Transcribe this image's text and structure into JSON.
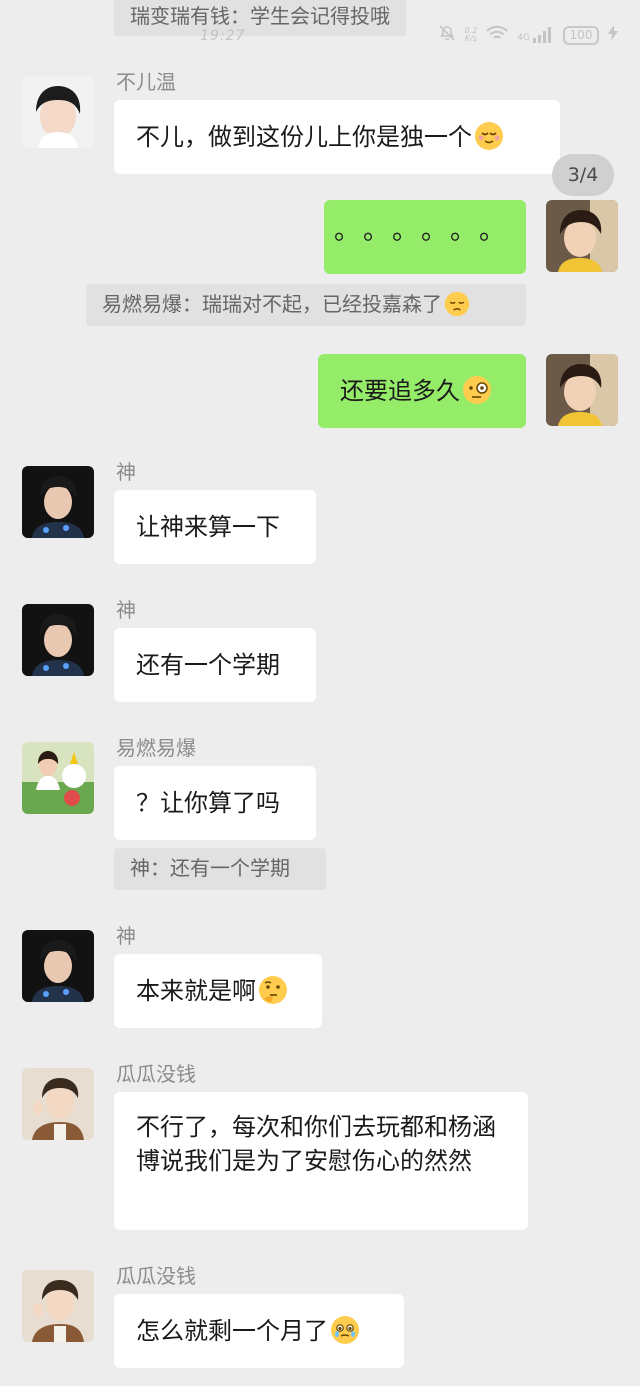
{
  "status": {
    "time": "19:27",
    "net_speed_top": "0.2",
    "net_speed_bottom": "K/s",
    "signal": "4G",
    "battery": "100"
  },
  "top_quote": {
    "text": "瑞变瑞有钱：学生会记得投哦"
  },
  "page_indicator": "3/4",
  "messages": [
    {
      "sender": "不儿温",
      "text": "不儿，做到这份儿上你是独一个",
      "emoji": "relieved-face-emoji"
    },
    {
      "sender": "",
      "text": "。。。。。。"
    },
    {
      "quote": "易燃易爆：瑞瑞对不起，已经投嘉森了",
      "emoji": "pensive-face-emoji"
    },
    {
      "sender": "",
      "text": "还要追多久",
      "emoji": "face-with-monocle-emoji"
    },
    {
      "sender": "神",
      "text": "让神来算一下"
    },
    {
      "sender": "神",
      "text": "还有一个学期"
    },
    {
      "sender": "易燃易爆",
      "text": "？让你算了吗"
    },
    {
      "quote": "神：还有一个学期"
    },
    {
      "sender": "神",
      "text": "本来就是啊",
      "emoji": "thinking-face-emoji"
    },
    {
      "sender": "瓜瓜没钱",
      "text": "不行了，每次和你们去玩都和杨涵博说我们是为了安慰伤心的然然"
    },
    {
      "sender": "瓜瓜没钱",
      "text": "怎么就剩一个月了",
      "emoji": "face-holding-back-tears-emoji"
    }
  ],
  "colors": {
    "background": "#ededed",
    "bubble_other": "#ffffff",
    "bubble_self": "#95ec69",
    "quote_bg": "#e1e1e1",
    "sender_name": "#8c8c8c"
  }
}
